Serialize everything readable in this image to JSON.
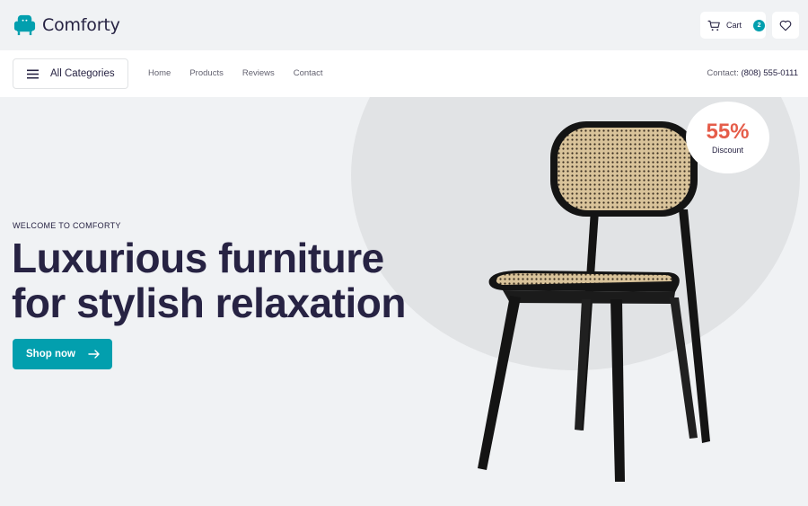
{
  "brand": {
    "name": "Comforty",
    "icon": "armchair-icon",
    "accent": "#029fae"
  },
  "header": {
    "cart_label": "Cart",
    "cart_count": "2",
    "cart_icon": "cart-icon",
    "wishlist_icon": "heart-icon"
  },
  "nav": {
    "categories_label": "All Categories",
    "links": [
      "Home",
      "Products",
      "Reviews",
      "Contact"
    ],
    "contact_label": "Contact:",
    "contact_phone": "(808) 555-0111"
  },
  "hero": {
    "eyebrow": "WELCOME TO COMFORTY",
    "headline_line1": "Luxurious furniture",
    "headline_line2": "for stylish relaxation",
    "cta_label": "Shop now",
    "discount_value": "55%",
    "discount_label": "Discount",
    "discount_color": "#e55d4a",
    "heading_color": "#272343"
  }
}
